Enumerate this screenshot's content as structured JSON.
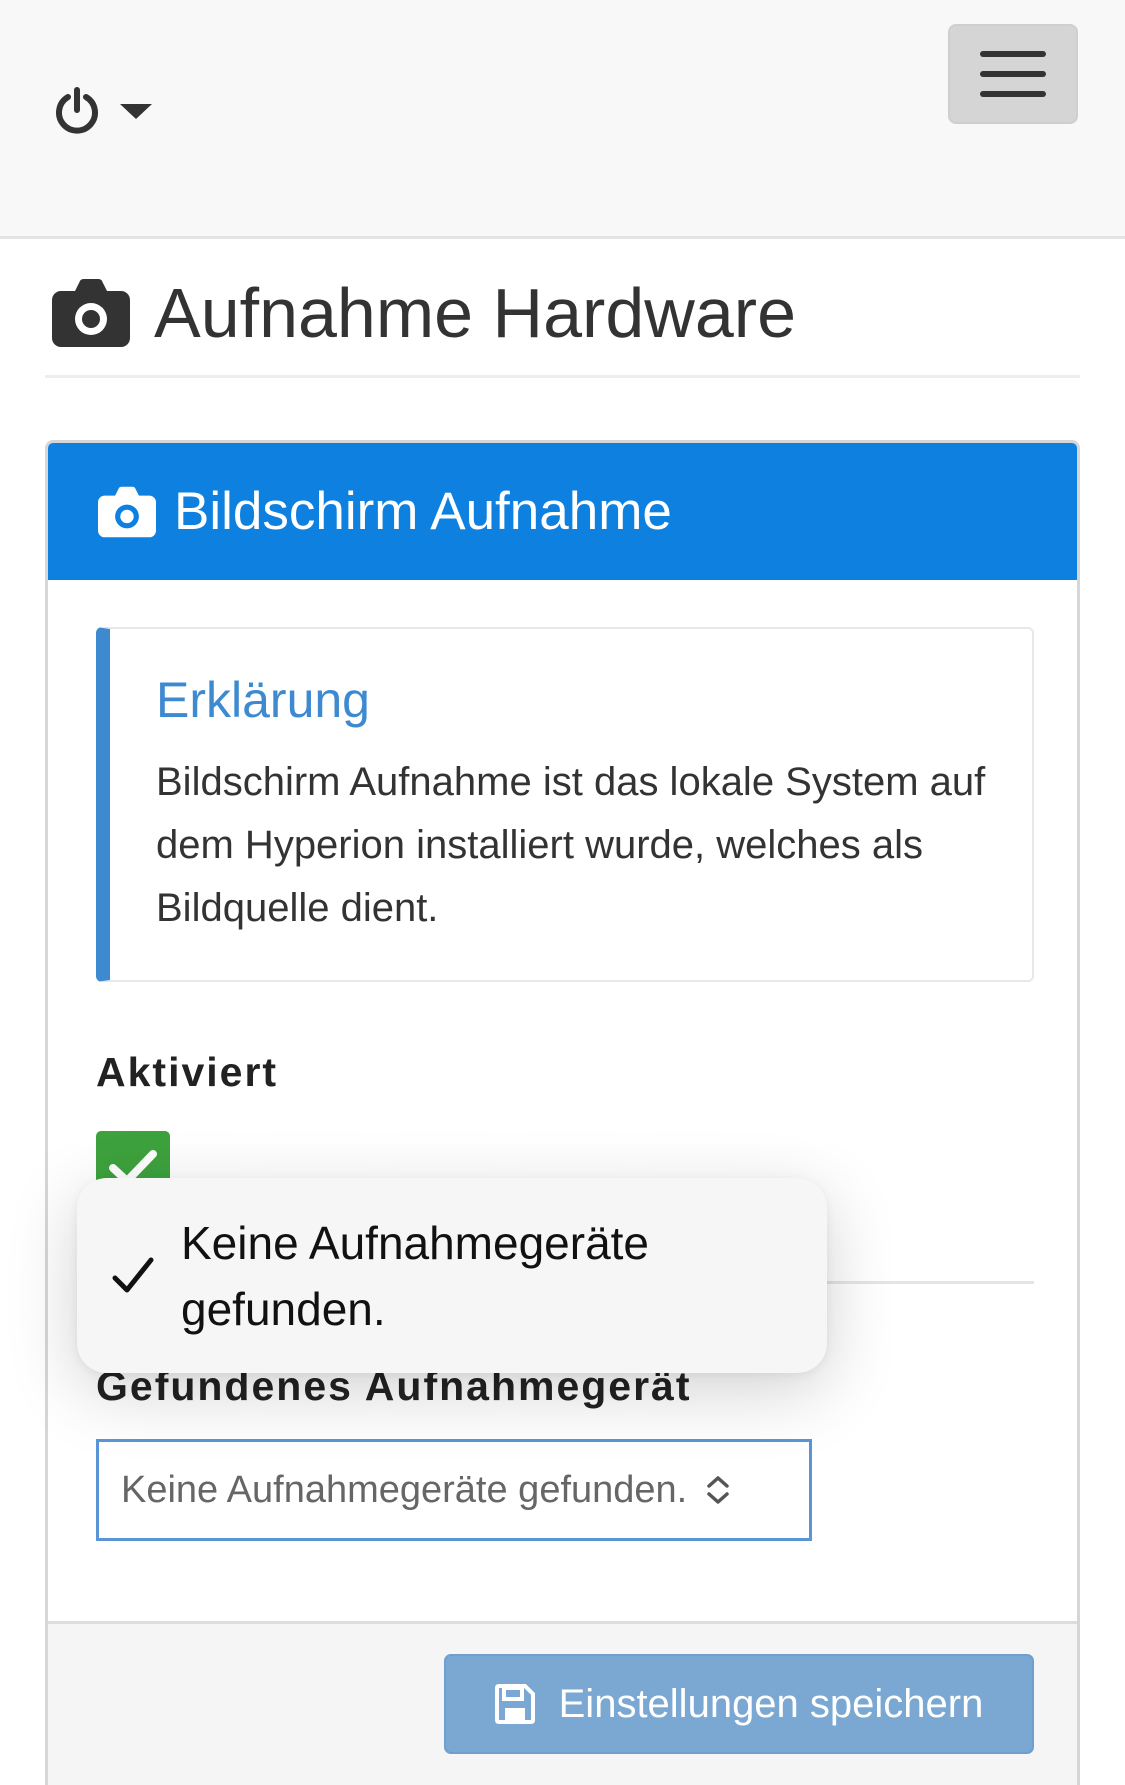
{
  "navbar": {
    "power_icon": "power-icon",
    "caret_icon": "caret-down-icon",
    "menu_icon": "hamburger-menu-icon"
  },
  "header": {
    "icon": "camera-icon",
    "title": "Aufnahme Hardware"
  },
  "panel": {
    "icon": "camera-icon",
    "title": "Bildschirm Aufnahme",
    "heading_color": "#0d80e0"
  },
  "callout": {
    "title": "Erklärung",
    "text": "Bildschirm Aufnahme ist das lokale System auf dem Hyperion installiert wurde, welches als Bildquelle dient.",
    "accent_color": "#3d8ad1"
  },
  "form": {
    "enabled_label": "Aktiviert",
    "enabled_checked": true,
    "device_label": "Gefundenes Aufnahmegerät",
    "device_value": "Keine Aufnahmegeräte gefunden."
  },
  "footer": {
    "save_label": "Einstellungen speichern",
    "save_icon": "floppy-disk-icon"
  },
  "toast": {
    "icon": "checkmark-icon",
    "text": "Keine Aufnahmegeräte gefunden."
  }
}
